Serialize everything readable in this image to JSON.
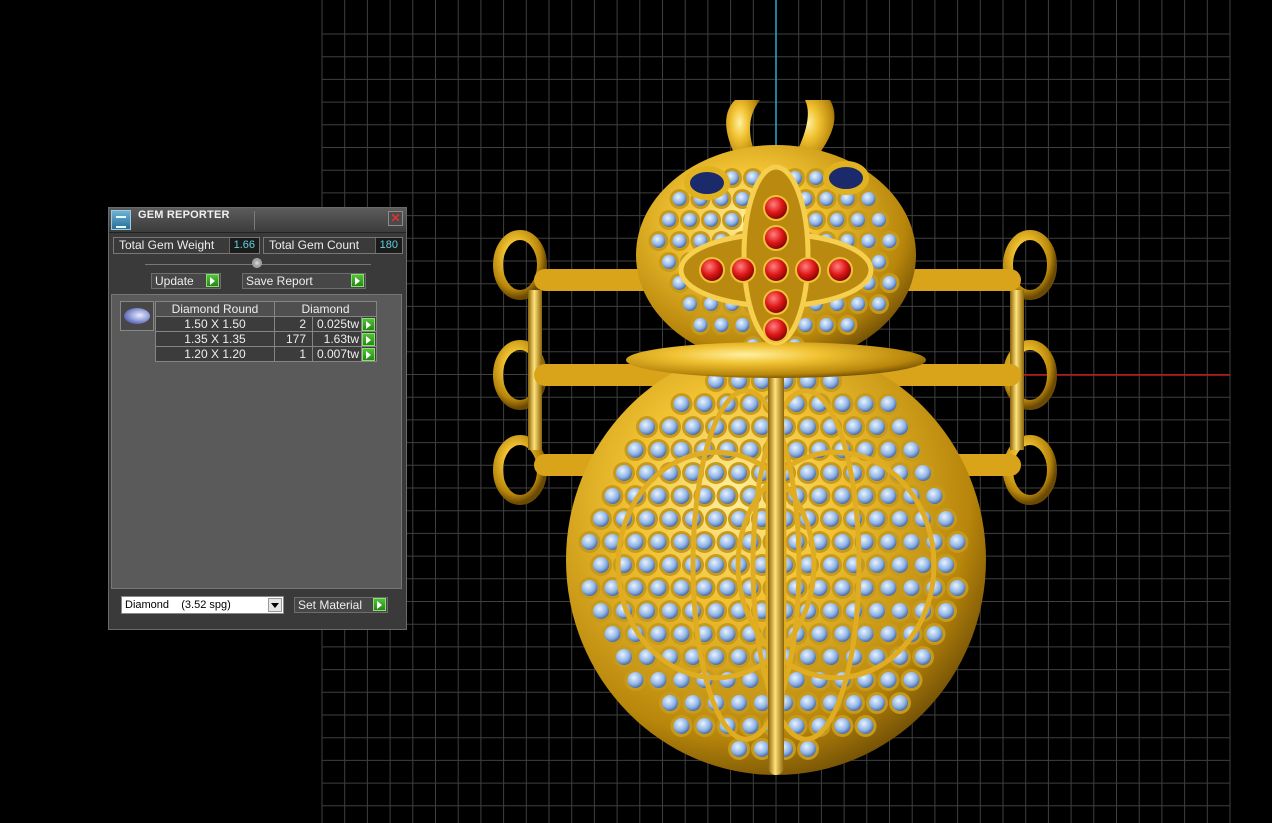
{
  "window": {
    "title": "GEM REPORTER"
  },
  "stats": {
    "weight_label": "Total Gem Weight",
    "weight_value": "1.66",
    "count_label": "Total Gem Count",
    "count_value": "180"
  },
  "buttons": {
    "update": "Update",
    "save_report": "Save Report",
    "set_material": "Set Material"
  },
  "gem_table": {
    "headers": [
      "Diamond Round",
      "Diamond"
    ],
    "rows": [
      {
        "size": "1.50 X 1.50",
        "count": "2",
        "weight": "0.025tw"
      },
      {
        "size": "1.35 X 1.35",
        "count": "177",
        "weight": "1.63tw"
      },
      {
        "size": "1.20 X 1.20",
        "count": "1",
        "weight": "0.007tw"
      }
    ]
  },
  "material_select": {
    "value": "Diamond    (3.52 spg)"
  },
  "colors": {
    "gold": "#d8a81c",
    "diamond_blue": "#8fb4e6",
    "ruby_red": "#d01010",
    "sapphire": "#1a2a6a",
    "grid_line": "#3f3f3f",
    "axis_blue": "#2fa9c8",
    "axis_red": "#c01c1c",
    "value_text": "#5fd3e0",
    "go_button": "#3aa828"
  },
  "icons": {
    "app": "gem-reporter-icon",
    "close": "close-icon",
    "go": "green-arrow-icon",
    "gem_preview": "round-diamond-icon"
  }
}
